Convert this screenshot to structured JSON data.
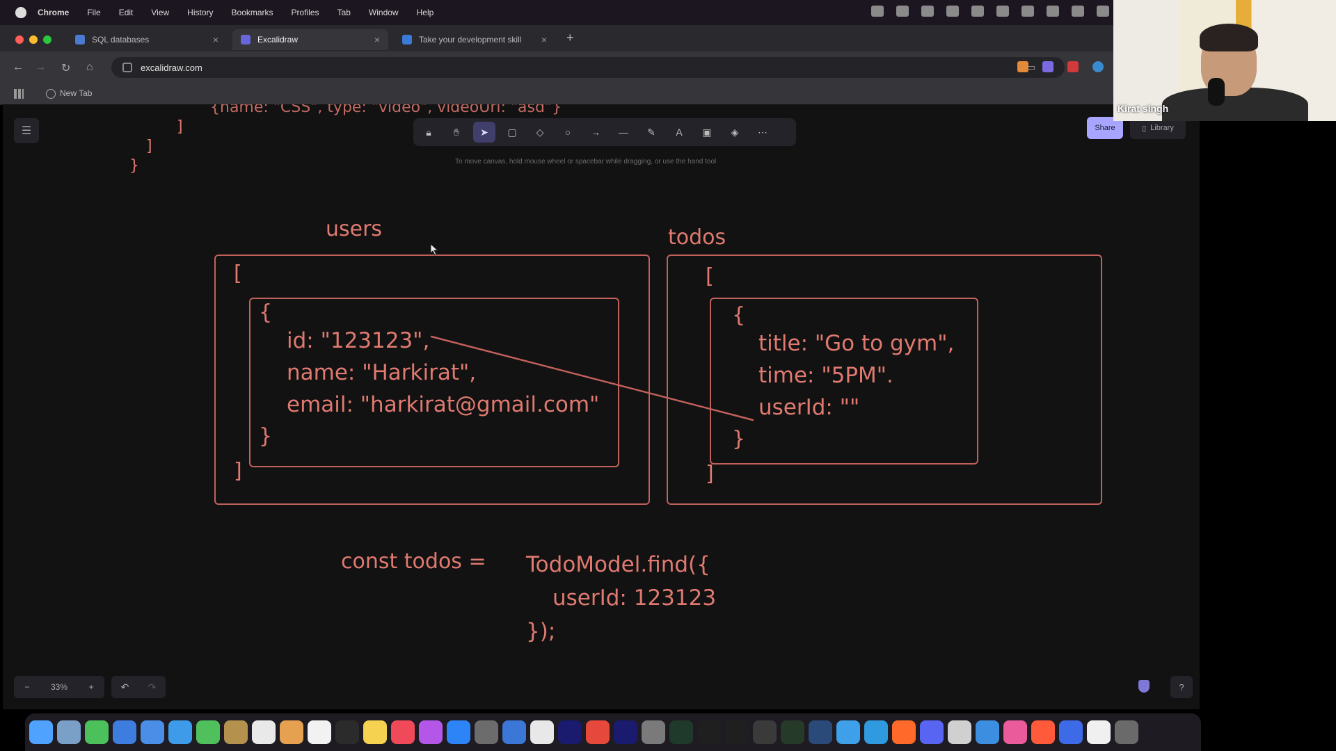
{
  "menubar": {
    "app": "Chrome",
    "items": [
      "File",
      "Edit",
      "View",
      "History",
      "Bookmarks",
      "Profiles",
      "Tab",
      "Window",
      "Help"
    ]
  },
  "browser": {
    "tabs": [
      {
        "title": "SQL databases",
        "favicon_color": "#4a7bd0"
      },
      {
        "title": "Excalidraw",
        "favicon_color": "#6965db"
      },
      {
        "title": "Take your development skill",
        "favicon_color": "#3b7bd8"
      }
    ],
    "new_tab_icon": "+",
    "url": "excalidraw.com",
    "bookmark": "New Tab"
  },
  "excalidraw": {
    "toolbar_tools": [
      "lock-icon",
      "hand-icon",
      "selection-icon",
      "rectangle-icon",
      "diamond-icon",
      "ellipse-icon",
      "arrow-icon",
      "line-icon",
      "draw-icon",
      "text-icon",
      "image-icon",
      "eraser-icon",
      "more-tools-icon"
    ],
    "active_tool_index": 2,
    "hint": "To move canvas, hold mouse wheel or spacebar while dragging, or use the hand tool",
    "share_label": "Share",
    "library_label": "Library",
    "zoom_level": "33%",
    "accent_color": "#a8a5ff",
    "ink_color": "#e07a70"
  },
  "drawing": {
    "top_code_line": "{name: \"CSS\", type: \"video\", videoUrl: \"asd\"}",
    "top_brackets": [
      "]",
      "]",
      "}"
    ],
    "users_label": "users",
    "todos_label": "todos",
    "users_open": "[",
    "users_obj_open": "{",
    "users_lines": [
      "id: \"123123\",",
      "name: \"Harkirat\",",
      "email: \"harkirat@gmail.com\""
    ],
    "users_obj_close": "}",
    "users_close": "]",
    "todos_open": "[",
    "todos_obj_open": "{",
    "todos_lines": [
      "title: \"Go to gym\",",
      "time: \"5PM\".",
      "userId: \"\""
    ],
    "todos_obj_close": "}",
    "todos_close": "]",
    "query_prefix": "const todos =",
    "query_lines": [
      "TodoModel.find({",
      "userId: 123123",
      "});"
    ]
  },
  "webcam": {
    "name": "Kirat singh"
  },
  "dock": {
    "icon_colors": [
      "#4fa3ff",
      "#7aa0c8",
      "#4cc05a",
      "#3e7de0",
      "#4a8ee8",
      "#3d9be9",
      "#4fc05c",
      "#b4924e",
      "#e9e9e9",
      "#e5a050",
      "#f2f2f2",
      "#2b2b2b",
      "#f5d24f",
      "#f04a5a",
      "#b457e8",
      "#2d84f6",
      "#6c6c6c",
      "#3b77d6",
      "#e8e8e8",
      "#1a1a6e",
      "#e6483b",
      "#1a1a6e",
      "#7a7a7a",
      "#1f3a2a",
      "#1f1f1f",
      "#1f1f1f",
      "#3a3a3a",
      "#263a2a",
      "#2a4a7a",
      "#3ea0e8",
      "#2f9ae0",
      "#ff6a2a",
      "#5865f2",
      "#d0d0d0",
      "#3c8ee0",
      "#e95b9b",
      "#ff5a3a",
      "#3d6be8",
      "#f0f0f0",
      "#6a6a6a"
    ]
  }
}
